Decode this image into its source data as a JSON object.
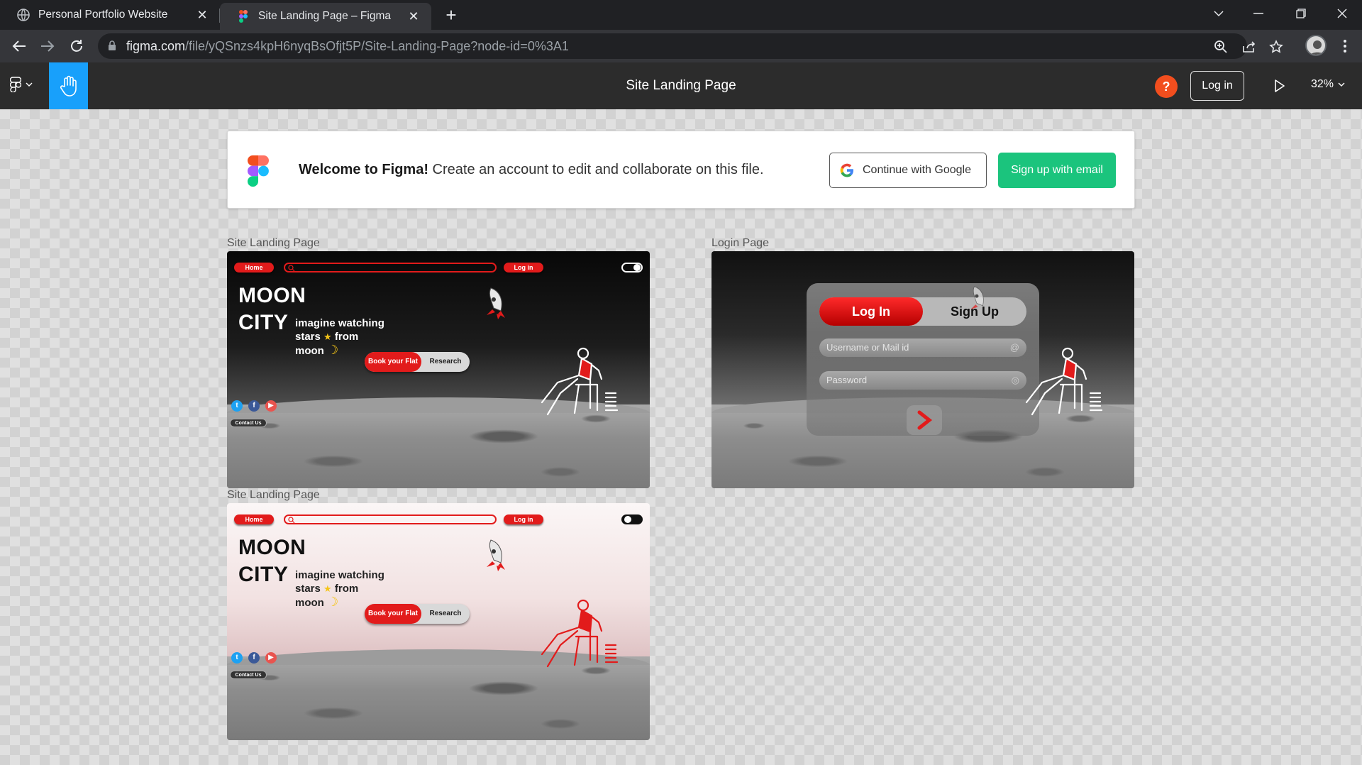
{
  "browser": {
    "tabs": [
      {
        "title": "Personal Portfolio Website",
        "active": false
      },
      {
        "title": "Site Landing Page – Figma",
        "active": true
      }
    ],
    "url": {
      "host": "figma.com",
      "path": "/file/yQSnzs4kpH6nyqBsOfjt5P/Site-Landing-Page?node-id=0%3A1"
    }
  },
  "figma": {
    "file_title": "Site Landing Page",
    "help_label": "?",
    "login_label": "Log in",
    "zoom": "32%"
  },
  "banner": {
    "welcome_bold": "Welcome to Figma!",
    "welcome_text": " Create an account to edit and collaborate on this file.",
    "google_label": "Continue with Google",
    "email_label": "Sign up with email"
  },
  "frames": [
    {
      "label": "Site Landing Page",
      "theme": "dark",
      "nav": {
        "home": "Home",
        "login": "Log in"
      },
      "title_line1": "MOON",
      "title_line2": "CITY",
      "tagline": [
        "imagine watching",
        "stars",
        "from",
        "moon"
      ],
      "buttons": {
        "book": "Book your Flat",
        "research": "Research"
      },
      "contact": "Contact Us"
    },
    {
      "label": "Login Page",
      "theme": "login",
      "tabs": {
        "login": "Log In",
        "signup": "Sign Up"
      },
      "fields": {
        "username": "Username or Mail id",
        "password": "Password"
      }
    },
    {
      "label": "Site Landing Page",
      "theme": "light",
      "nav": {
        "home": "Home",
        "login": "Log in"
      },
      "title_line1": "MOON",
      "title_line2": "CITY",
      "tagline": [
        "imagine watching",
        "stars",
        "from",
        "moon"
      ],
      "buttons": {
        "book": "Book your Flat",
        "research": "Research"
      },
      "contact": "Contact Us"
    }
  ],
  "colors": {
    "figma_blue": "#18a0fb",
    "figma_green": "#1bc47d",
    "help_orange": "#f24e1e",
    "brand_red": "#e21b1b"
  },
  "icons": [
    "globe-icon",
    "figma-icon",
    "close-icon",
    "plus-icon",
    "back-icon",
    "forward-icon",
    "reload-icon",
    "lock-icon",
    "zoom-icon",
    "share-icon",
    "star-icon",
    "hand-icon",
    "play-icon",
    "chevron-down-icon"
  ]
}
